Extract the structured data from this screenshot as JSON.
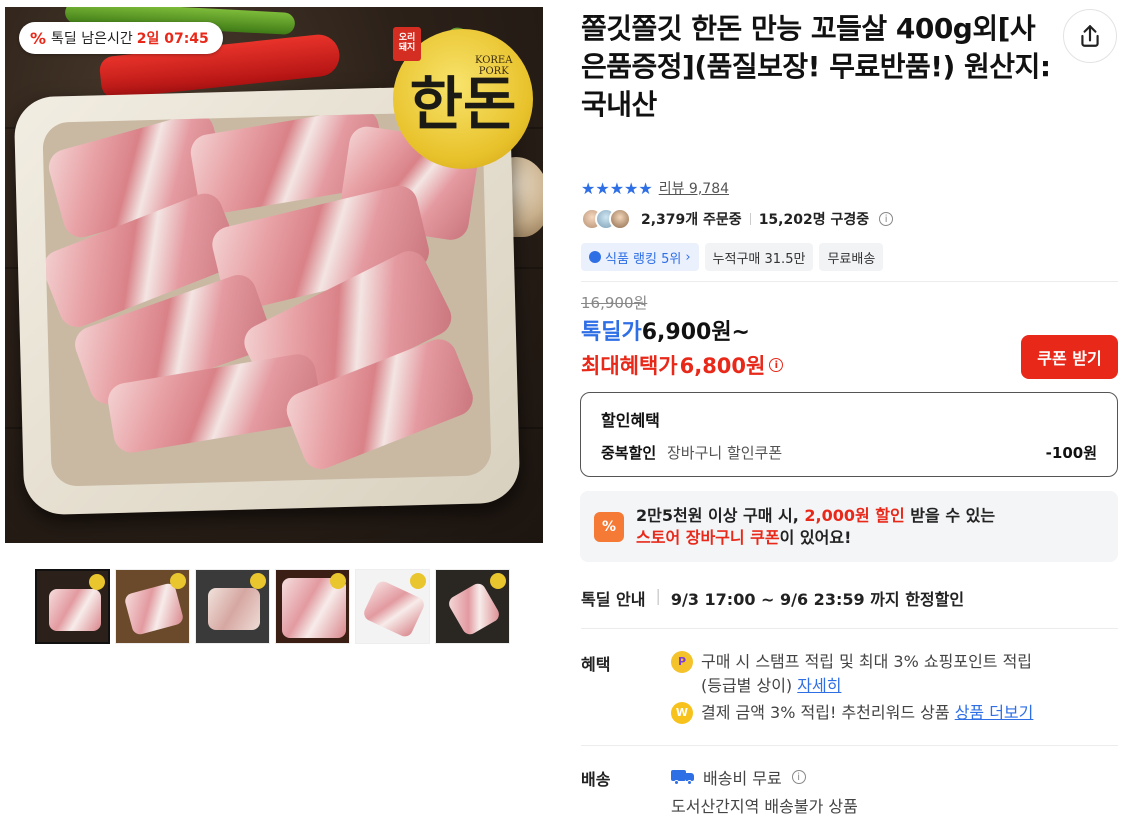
{
  "timer": {
    "label": "톡딜 남은시간",
    "remaining": "2일 07:45"
  },
  "image": {
    "seal_small": "오리\n돼지",
    "seal_main": "한돈",
    "seal_en": "KOREA\nPORK"
  },
  "thumbnails": [
    "thumb-1",
    "thumb-2",
    "thumb-3",
    "thumb-4",
    "thumb-5",
    "thumb-6"
  ],
  "product": {
    "title": "쫄깃쫄깃 한돈 만능 꼬들살 400g외[사은품증정](품질보장! 무료반품!) 원산지: 국내산"
  },
  "rating": {
    "stars": "★★★★★",
    "review_text": "리뷰 9,784"
  },
  "orders": {
    "ordering": "2,379개 주문중",
    "viewing": "15,202명 구경중"
  },
  "badges": [
    {
      "label": "식품 랭킹 5위",
      "arrow": "›"
    },
    {
      "label": "누적구매 31.5만"
    },
    {
      "label": "무료배송"
    }
  ],
  "price": {
    "original": "16,900원",
    "deal_label": "톡딜가",
    "deal_value": "6,900원~",
    "max_label": "최대혜택가",
    "max_value": "6,800원"
  },
  "coupon_button": "쿠폰 받기",
  "discount": {
    "heading": "할인혜택",
    "row_label": "중복할인",
    "row_value": "장바구니 할인쿠폰",
    "row_amount": "-100원"
  },
  "store_coupon": {
    "icon": "%",
    "line1_a": "2만5천원 이상 구매 시, ",
    "line1_red": "2,000원 할인",
    "line1_b": " 받을 수 있는",
    "line2_red": "스토어 장바구니 쿠폰",
    "line2_b": "이 있어요!"
  },
  "deal_info": {
    "label": "톡딜 안내",
    "value": "9/3 17:00 ~ 9/6 23:59 까지 한정할인"
  },
  "benefits": {
    "label": "혜택",
    "row1_text": "구매 시 스탬프 적립 및 최대 3% 쇼핑포인트 적립",
    "row1_text2": "(등급별 상이)",
    "row1_link": "자세히",
    "row2_text": "결제 금액 3% 적립! 추천리워드 상품",
    "row2_link": "상품 더보기"
  },
  "shipping": {
    "label": "배송",
    "fee": "배송비 무료",
    "note": "도서산간지역 배송불가 상품"
  },
  "colors": {
    "accent_blue": "#2f6fe6",
    "accent_red": "#e8291a"
  }
}
